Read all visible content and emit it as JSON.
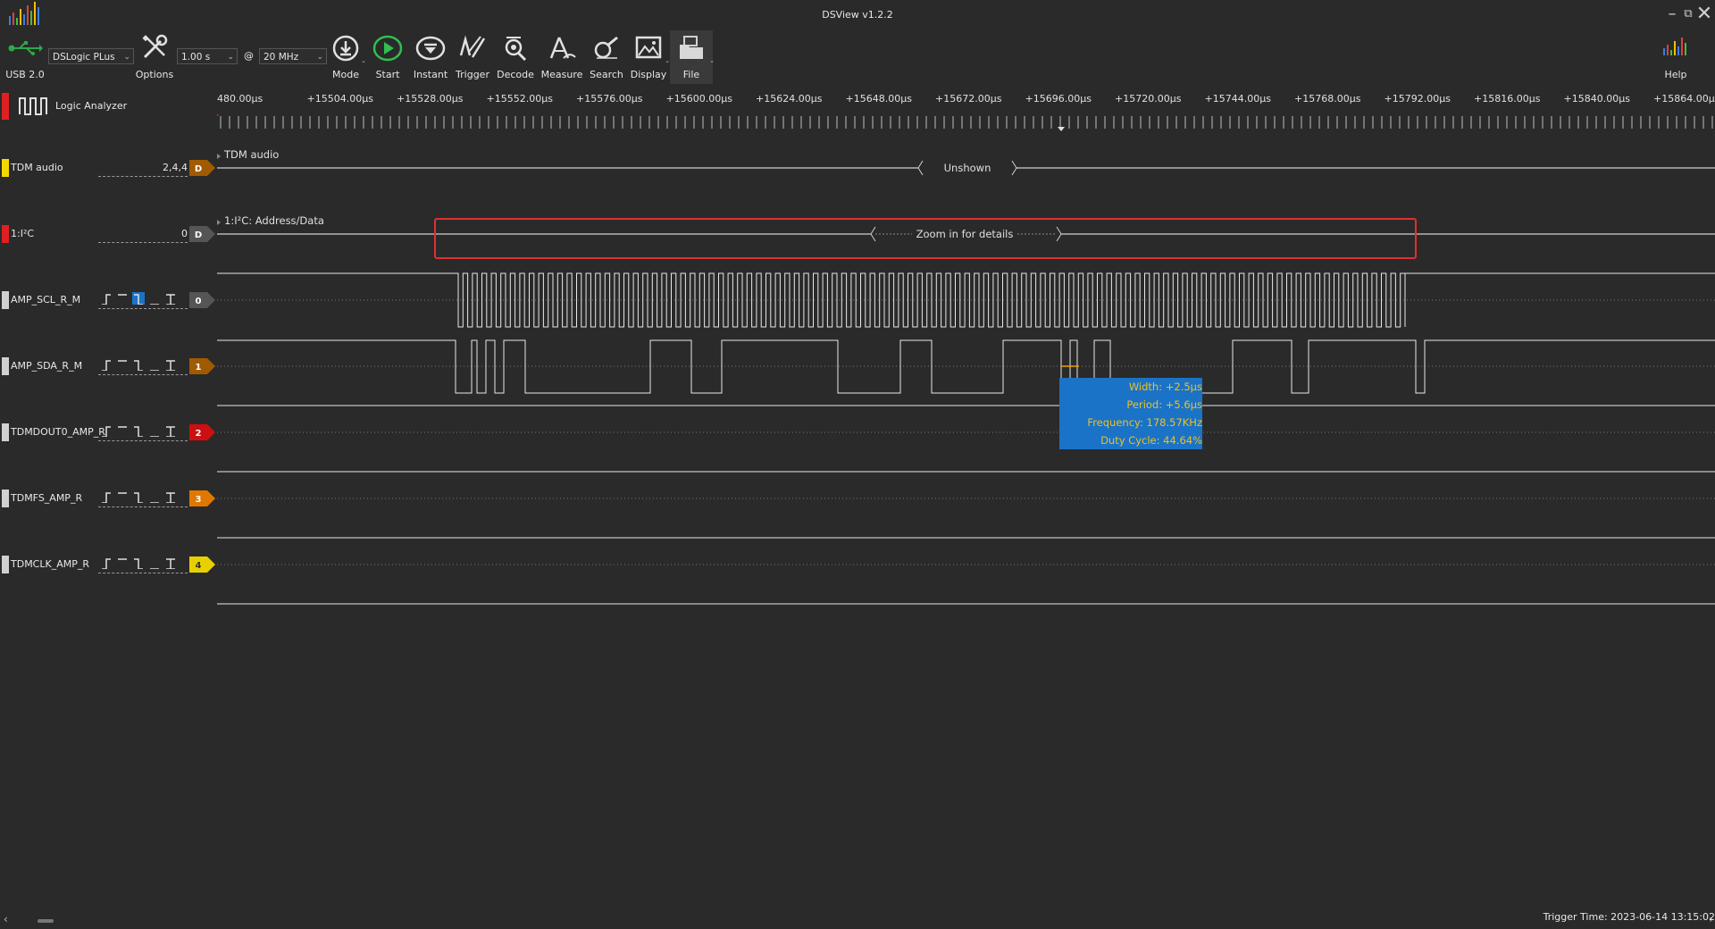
{
  "window": {
    "title": "DSView v1.2.2"
  },
  "toolbar": {
    "usb_label": "USB 2.0",
    "device": "DSLogic PLus",
    "options_label": "Options",
    "duration": "1.00 s",
    "at_sign": "@",
    "rate": "20 MHz",
    "mode_label": "Mode",
    "start_label": "Start",
    "instant_label": "Instant",
    "trigger_label": "Trigger",
    "decode_label": "Decode",
    "measure_label": "Measure",
    "search_label": "Search",
    "display_label": "Display",
    "file_label": "File",
    "help_label": "Help"
  },
  "mode_label": "Logic Analyzer",
  "ruler": {
    "ticks": [
      "480.00µs",
      "+15504.00µs",
      "+15528.00µs",
      "+15552.00µs",
      "+15576.00µs",
      "+15600.00µs",
      "+15624.00µs",
      "+15648.00µs",
      "+15672.00µs",
      "+15696.00µs",
      "+15720.00µs",
      "+15744.00µs",
      "+15768.00µs",
      "+15792.00µs",
      "+15816.00µs",
      "+15840.00µs",
      "+15864.00µs"
    ]
  },
  "channels": [
    {
      "name": "TDM audio",
      "value": "2,4,4",
      "tag": "D",
      "color": "#f5d800",
      "tag_color": "#a05a00",
      "decoder": true
    },
    {
      "name": "1:I²C",
      "value": "0",
      "tag": "D",
      "color": "#e02020",
      "tag_color": "#555555",
      "decoder": true
    },
    {
      "name": "AMP_SCL_R_M",
      "tag": "0",
      "color": "#d0d0d0",
      "tag_color": "#555555"
    },
    {
      "name": "AMP_SDA_R_M",
      "tag": "1",
      "color": "#d0d0d0",
      "tag_color": "#a05a00"
    },
    {
      "name": "TDMDOUT0_AMP_R",
      "tag": "2",
      "color": "#d0d0d0",
      "tag_color": "#cc1010"
    },
    {
      "name": "TDMFS_AMP_R",
      "tag": "3",
      "color": "#d0d0d0",
      "tag_color": "#e07800"
    },
    {
      "name": "TDMCLK_AMP_R",
      "tag": "4",
      "color": "#d0d0d0",
      "tag_color": "#e8d000"
    }
  ],
  "decoders": {
    "tdm_title": "TDM audio",
    "tdm_text": "Unshown",
    "i2c_title": "1:I²C: Address/Data",
    "i2c_text": "Zoom in for details"
  },
  "measure_popup": {
    "width": "Width: +2.5µs",
    "period": "Period: +5.6µs",
    "frequency": "Frequency: 178.57KHz",
    "duty": "Duty Cycle: 44.64%"
  },
  "status": {
    "trigger_time": "Trigger Time: 2023-06-14 13:15:02"
  },
  "colors": {
    "background": "#2a2a2a",
    "highlight": "#e03030",
    "popup": "#1a73c7",
    "popup_text": "#f0c020"
  }
}
